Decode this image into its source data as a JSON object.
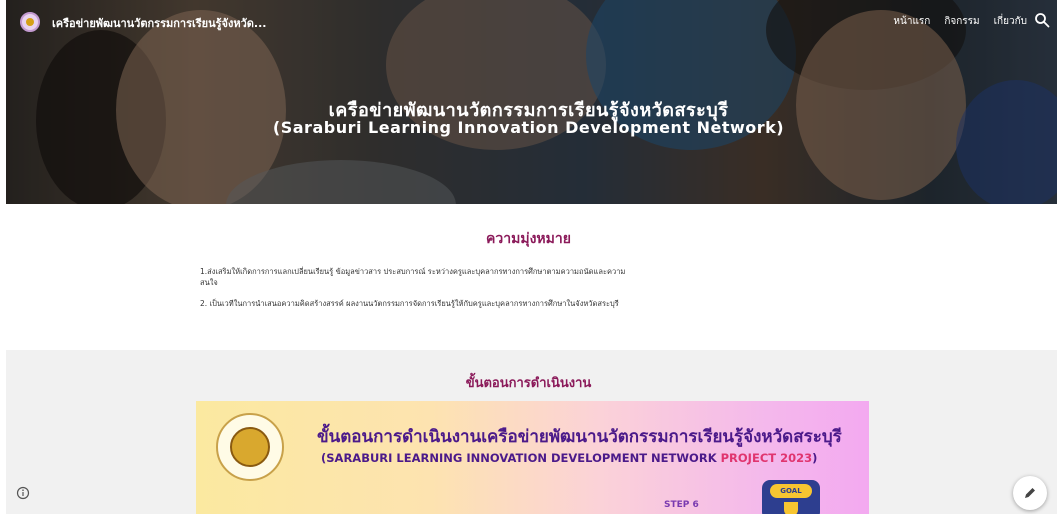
{
  "header": {
    "site_title": "เครือข่ายพัฒนานวัตกรรมการเรียนรู้จังหวัด...",
    "nav": [
      "หน้าแรก",
      "กิจกรรม",
      "เกี่ยวกับ"
    ],
    "icons": {
      "search": "search-icon",
      "logo": "site-logo-icon"
    }
  },
  "hero": {
    "title_th": "เครือข่ายพัฒนานวัตกรรมการเรียนรู้จังหวัดสระบุรี",
    "title_en": "(Saraburi Learning Innovation Development Network)"
  },
  "mission": {
    "heading": "ความมุ่งหมาย",
    "items": [
      "1.ส่งเสริมให้เกิดการการแลกเปลี่ยนเรียนรู้ ข้อมูลข่าวสาร ประสบการณ์ ระหว่างครูและบุคลากรทางการศึกษาตามความถนัดและความสนใจ",
      "2. เป็นเวทีในการนำเสนอความคิดสร้างสรรค์ ผลงานนวัตกรรมการจัดการเรียนรู้ให้กับครูและบุคลากรทางการศึกษาในจังหวัดสระบุรี"
    ]
  },
  "process": {
    "heading": "ขั้นตอนการดำเนินงาน",
    "banner": {
      "title": "ขั้นตอนการดำเนินงานเครือข่ายพัฒนานวัตกรรมการเรียนรู้จังหวัดสระบุรี",
      "subtitle": "(SARABURI LEARNING INNOVATION DEVELOPMENT NETWORK",
      "project": "PROJECT 2023",
      "closing": ")",
      "step": "STEP 6",
      "goal": "GOAL"
    }
  },
  "colors": {
    "heading": "#8b1a5a",
    "banner_text": "#4b1a8a",
    "highlight": "#e0356f"
  },
  "footer_icons": {
    "info": "info-icon",
    "edit": "edit-pencil-icon"
  }
}
